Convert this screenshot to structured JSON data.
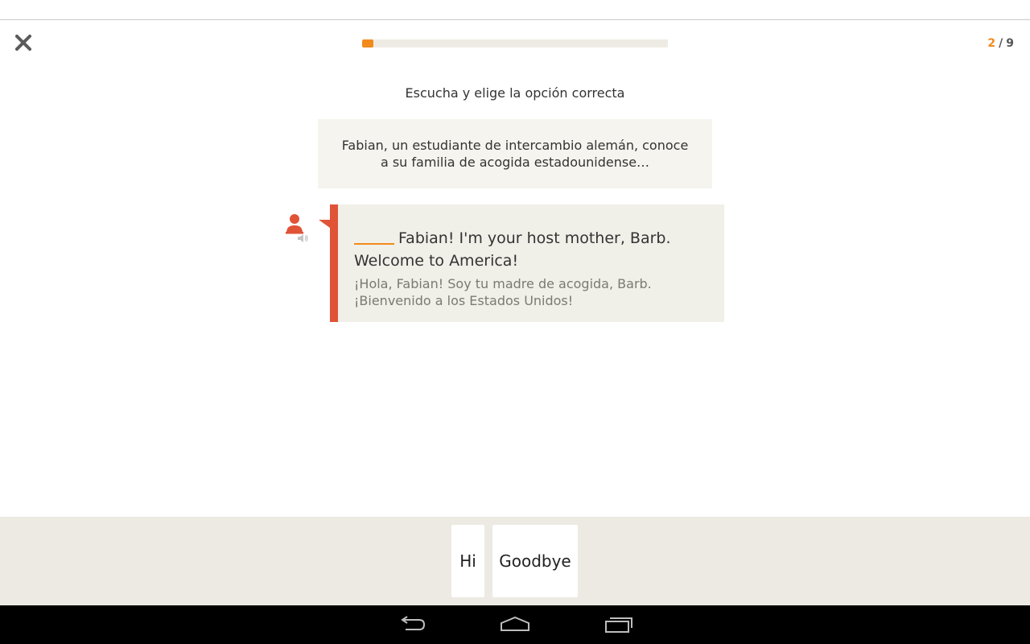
{
  "header": {
    "close_icon": "close-icon",
    "progress_fraction": 0.037,
    "counter_current": "2",
    "counter_separator": "/",
    "counter_total": "9"
  },
  "exercise": {
    "instruction": "Escucha y elige la opción correcta",
    "context": "Fabian, un estudiante de intercambio alemán, conoce a su familia de acogida estadounidense…",
    "dialog_en_after_blank": "Fabian! I'm your host mother, Barb. Welcome to America!",
    "dialog_es": "¡Hola, Fabian! Soy tu madre de acogida, Barb. ¡Bienvenido a los Estados Unidos!",
    "speaker_icon": "person-icon",
    "audio_icon": "speaker-icon"
  },
  "answers": [
    {
      "label": "Hi"
    },
    {
      "label": "Goodbye"
    }
  ],
  "navbar": {
    "back_icon": "back-icon",
    "home_icon": "home-icon",
    "recents_icon": "recents-icon"
  },
  "colors": {
    "accent": "#f28a1c",
    "dialog_accent": "#e05336",
    "bar_bg": "#eceae2"
  }
}
